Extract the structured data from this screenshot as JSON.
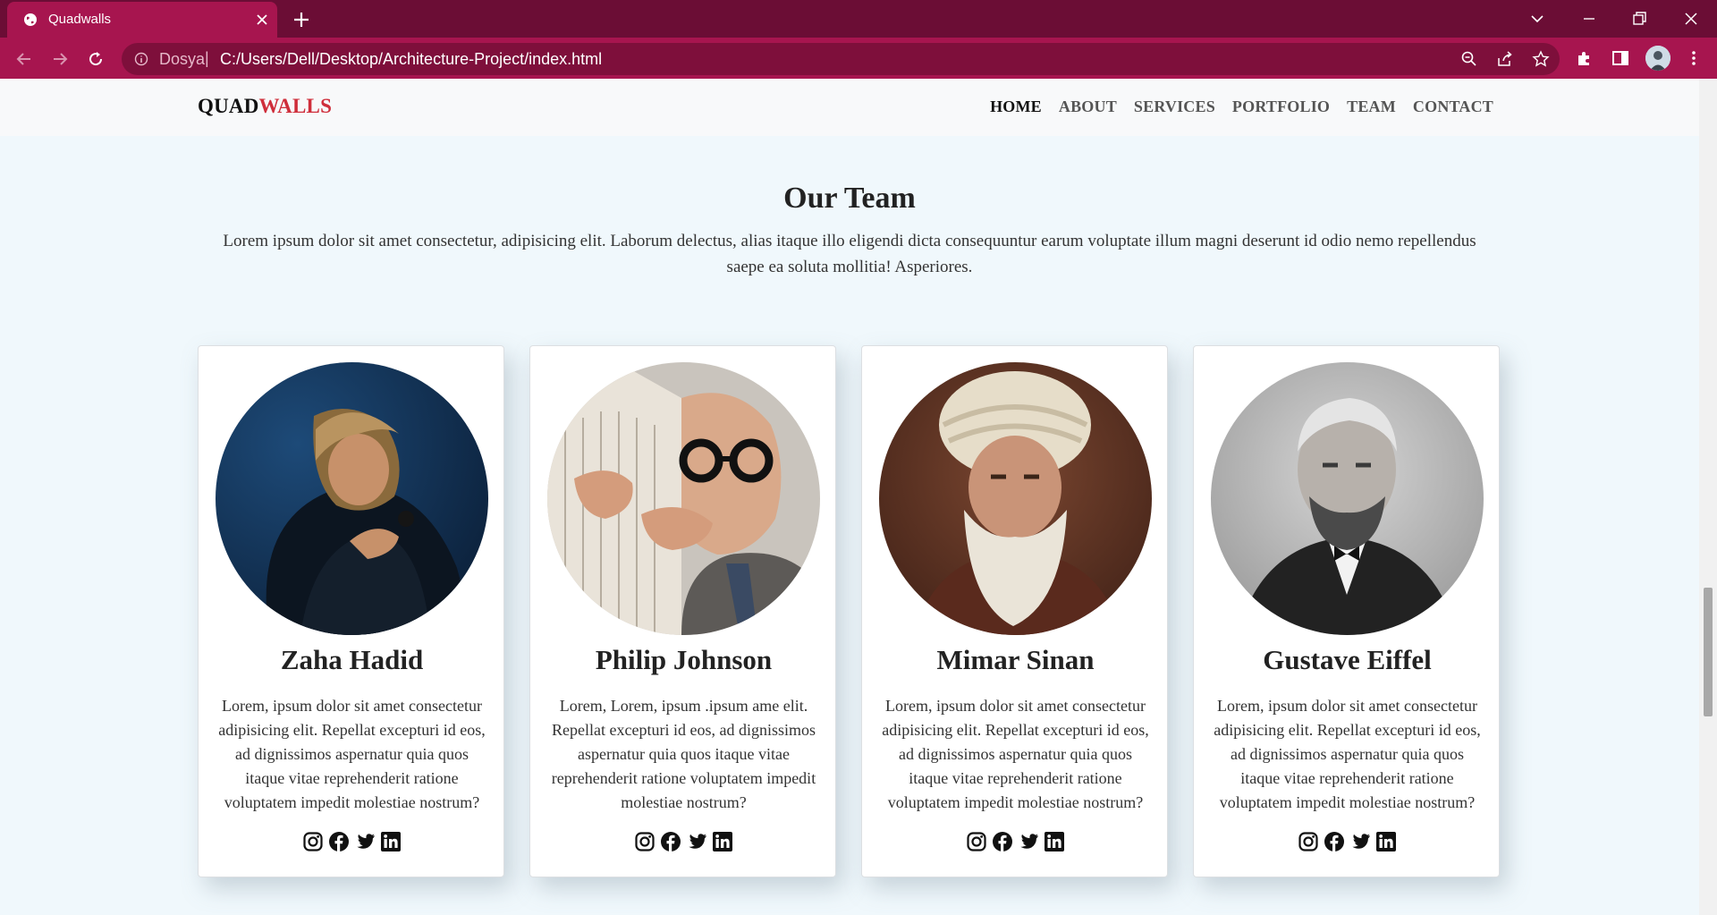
{
  "browser": {
    "tab_title": "Quadwalls",
    "url_prefix": "Dosya",
    "url_separator": "|",
    "url": "C:/Users/Dell/Desktop/Architecture-Project/index.html",
    "theme_color": "#a7154f"
  },
  "site": {
    "brand_part1": "QUAD",
    "brand_part2": "WALLS",
    "brand_accent": "#cf2e3b",
    "nav": [
      {
        "label": "HOME",
        "active": true
      },
      {
        "label": "ABOUT",
        "active": false
      },
      {
        "label": "SERVICES",
        "active": false
      },
      {
        "label": "PORTFOLIO",
        "active": false
      },
      {
        "label": "TEAM",
        "active": false
      },
      {
        "label": "CONTACT",
        "active": false
      }
    ]
  },
  "team": {
    "title": "Our Team",
    "intro": "Lorem ipsum dolor sit amet consectetur, adipisicing elit. Laborum delectus, alias itaque illo eligendi dicta consequuntur earum voluptate illum magni deserunt id odio nemo repellendus saepe ea soluta mollitia! Asperiores.",
    "members": [
      {
        "name": "Zaha Hadid",
        "bio": "Lorem, ipsum dolor sit amet consectetur adipisicing elit. Repellat excepturi id eos, ad dignissimos aspernatur quia quos itaque vitae reprehenderit ratione voluptatem impedit molestiae nostrum?",
        "photo": "portrait-zaha-hadid"
      },
      {
        "name": "Philip Johnson",
        "bio": "Lorem, Lorem, ipsum .ipsum ame elit. Repellat excepturi id eos, ad dignissimos aspernatur quia quos itaque vitae reprehenderit ratione voluptatem impedit molestiae nostrum?",
        "photo": "portrait-philip-johnson"
      },
      {
        "name": "Mimar Sinan",
        "bio": "Lorem, ipsum dolor sit amet consectetur adipisicing elit. Repellat excepturi id eos, ad dignissimos aspernatur quia quos itaque vitae reprehenderit ratione voluptatem impedit molestiae nostrum?",
        "photo": "portrait-mimar-sinan"
      },
      {
        "name": "Gustave Eiffel",
        "bio": "Lorem, ipsum dolor sit amet consectetur adipisicing elit. Repellat excepturi id eos, ad dignissimos aspernatur quia quos itaque vitae reprehenderit ratione voluptatem impedit molestiae nostrum?",
        "photo": "portrait-gustave-eiffel"
      }
    ],
    "social_icons": [
      "instagram-icon",
      "facebook-icon",
      "twitter-icon",
      "linkedin-icon"
    ]
  }
}
